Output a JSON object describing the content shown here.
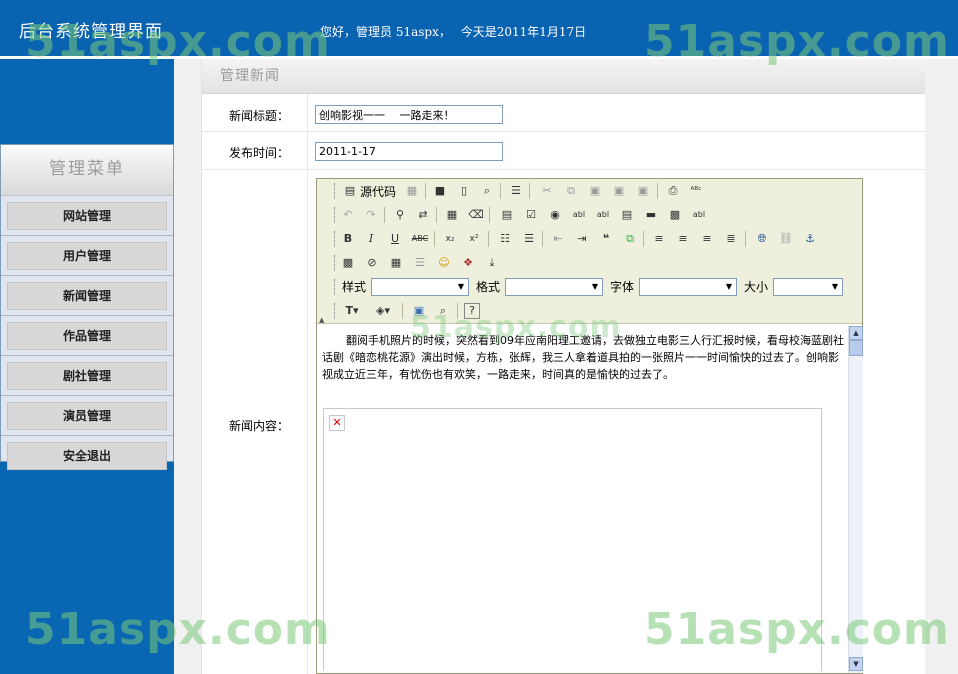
{
  "header": {
    "title": "后台系统管理界面",
    "greeting_hello": "您好，管理员 51aspx，",
    "greeting_date": "今天是2011年1月17日"
  },
  "sidebar": {
    "title": "管理菜单",
    "items": [
      "网站管理",
      "用户管理",
      "新闻管理",
      "作品管理",
      "剧社管理",
      "演员管理",
      "安全退出"
    ]
  },
  "panel": {
    "title": "管理新闻"
  },
  "form": {
    "title_label": "新闻标题：",
    "title_value": "创响影视一一　 一路走来！",
    "time_label": "发布时间：",
    "time_value": "2011-1-17",
    "content_label": "新闻内容："
  },
  "editor": {
    "source_label": "源代码",
    "style_label": "样式",
    "format_label": "格式",
    "font_label": "字体",
    "size_label": "大小",
    "content": "翻阅手机照片的时候，突然看到09年应南阳理工邀请，去做独立电影三人行汇报时候，看母校海蓝剧社话剧《暗恋桃花源》演出时候，方栋，张辉，我三人拿着道具拍的一张照片一一时间愉快的过去了。创响影视成立近三年，有忧伤也有欢笑，一路走来，时间真的是愉快的过去了。"
  },
  "watermark": {
    "text": "51aspx.com"
  },
  "colors": {
    "header_bg": "#0a63b0",
    "sidebar_bg": "#0866b3",
    "toolbar_bg": "#efefde"
  }
}
